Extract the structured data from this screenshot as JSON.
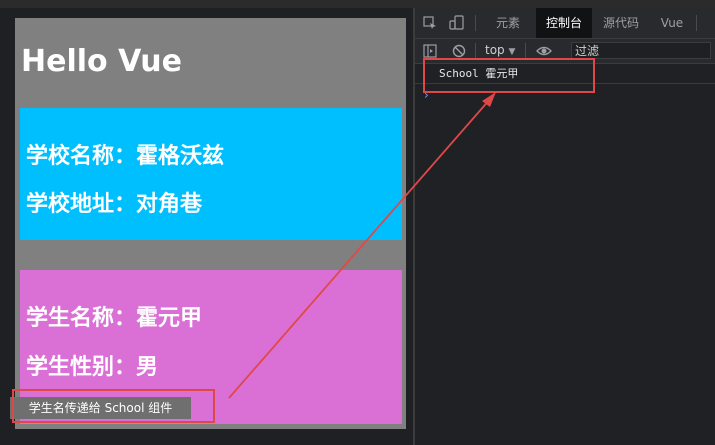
{
  "page": {
    "title": "Hello Vue",
    "school": {
      "name_label": "学校名称：霍格沃兹",
      "address_label": "学校地址：对角巷"
    },
    "student": {
      "name_label": "学生名称：霍元甲",
      "gender_label": "学生性别：男"
    },
    "send_button_label": "学生名传递给 School 组件"
  },
  "devtools": {
    "tabs": [
      {
        "label": "元素",
        "active": false
      },
      {
        "label": "控制台",
        "active": true
      },
      {
        "label": "源代码",
        "active": false
      },
      {
        "label": "Vue",
        "active": false
      }
    ],
    "toolbar": {
      "context": "top",
      "filter_placeholder": "过滤"
    },
    "console_log": "School 霍元甲",
    "icons": [
      "inspect-icon",
      "device-icon",
      "sidebar-icon",
      "clear-icon",
      "eye-icon"
    ]
  },
  "colors": {
    "app_bg": "#808080",
    "school_bg": "#00bfff",
    "student_bg": "#da70d6",
    "annotation": "#e04848"
  }
}
